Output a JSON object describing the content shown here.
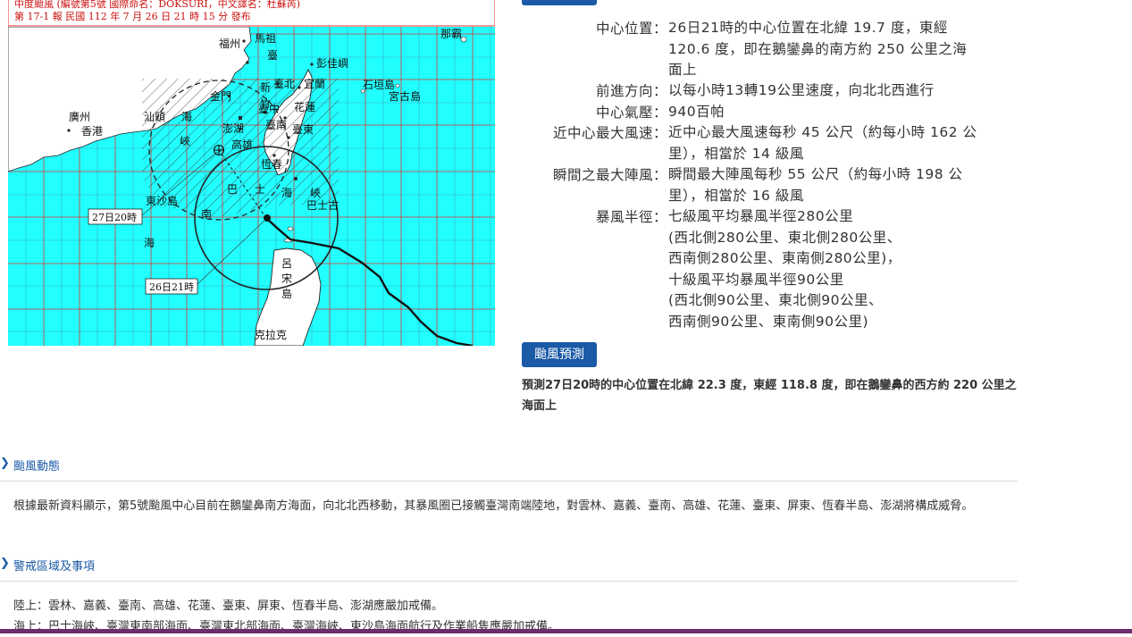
{
  "map": {
    "header_line1": "中度颱風 (編號第5號 國際命名：DOKSURI，中文譯名：杜蘇芮)",
    "header_line2": "第 17-1 報  民國 112 年 7 月 26 日 21 時 15 分 發布",
    "callout_27": "27日20時",
    "callout_26": "26日21時",
    "places": {
      "fuzhou": "福州",
      "mazu": "馬祖",
      "tai": "臺",
      "pengjiayu": "彭佳嶼",
      "naba": "那霸",
      "taibei": "臺北",
      "yilan": "宜蘭",
      "ishigaki": "石垣島",
      "miyako": "宮古島",
      "jinmen": "金門",
      "xin": "新",
      "zhu": "竹",
      "taizhong": "臺中",
      "hualian": "花蓮",
      "guangzhou": "廣州",
      "xianggang": "香港",
      "shantou": "汕頭",
      "hai": "海",
      "xia": "峽",
      "penghu": "澎湖",
      "taiwan_nan": "臺南",
      "gaoxiong": "高雄",
      "taidong": "臺東",
      "hengchun": "恆春",
      "ba": "巴",
      "shi": "士",
      "hai2": "海",
      "xia2": "峽",
      "bashi": "巴士古",
      "dongsha": "東沙島",
      "nan": "南",
      "hai3": "海",
      "lu": "呂",
      "song": "宋",
      "dao": "島",
      "kelake": "克拉克"
    }
  },
  "info": {
    "rows": [
      {
        "key": "中心位置：",
        "value": "26日21時的中心位置在北緯 19.7 度，東經\n120.6 度，即在鵝鑾鼻的南方約 250 公里之海\n面上"
      },
      {
        "key": "前進方向：",
        "value": "以每小時13轉19公里速度，向北北西進行"
      },
      {
        "key": "中心氣壓：",
        "value": "940百帕"
      },
      {
        "key": "近中心最大風速：",
        "value": "近中心最大風速每秒 45 公尺（約每小時 162 公\n里），相當於 14 級風"
      },
      {
        "key": "瞬間之最大陣風：",
        "value": "瞬間最大陣風每秒 55 公尺（約每小時 198 公\n里），相當於 16 級風"
      },
      {
        "key": "暴風半徑：",
        "value": "七級風平均暴風半徑280公里\n(西北側280公里、東北側280公里、\n西南側280公里、東南側280公里)，\n十級風平均暴風半徑90公里\n(西北側90公里、東北側90公里、\n西南側90公里、東南側90公里)"
      }
    ],
    "forecast_tab": "颱風預測",
    "forecast_text": "預測27日20時的中心位置在北緯 22.3 度，東經 118.8 度，即在鵝鑾鼻的西方約 220 公里之海面上"
  },
  "sections": [
    {
      "title": "颱風動態",
      "body": "根據最新資料顯示，第5號颱風中心目前在鵝鑾鼻南方海面，向北北西移動，其暴風圈已接觸臺灣南端陸地，對雲林、嘉義、臺南、高雄、花蓮、臺東、屏東、恆春半島、澎湖將構成威脅。"
    },
    {
      "title": "警戒區域及事項",
      "body": "陸上：雲林、嘉義、臺南、高雄、花蓮、臺東、屏東、恆春半島、澎湖應嚴加戒備。\n海上：巴士海峽、臺灣東南部海面、臺灣東北部海面、臺灣海峽、東沙島海面航行及作業船隻應嚴加戒備。"
    }
  ],
  "colors": {
    "sea": "#22ffff",
    "land": "#ffffff",
    "grid_red": "#dd3333",
    "accent_blue": "#1a5aa6",
    "bottom_bar": "#6b2d6b"
  },
  "icons": {
    "section_chevron": "chevron-right-icon",
    "typhoon_center": "typhoon-symbol-icon"
  }
}
